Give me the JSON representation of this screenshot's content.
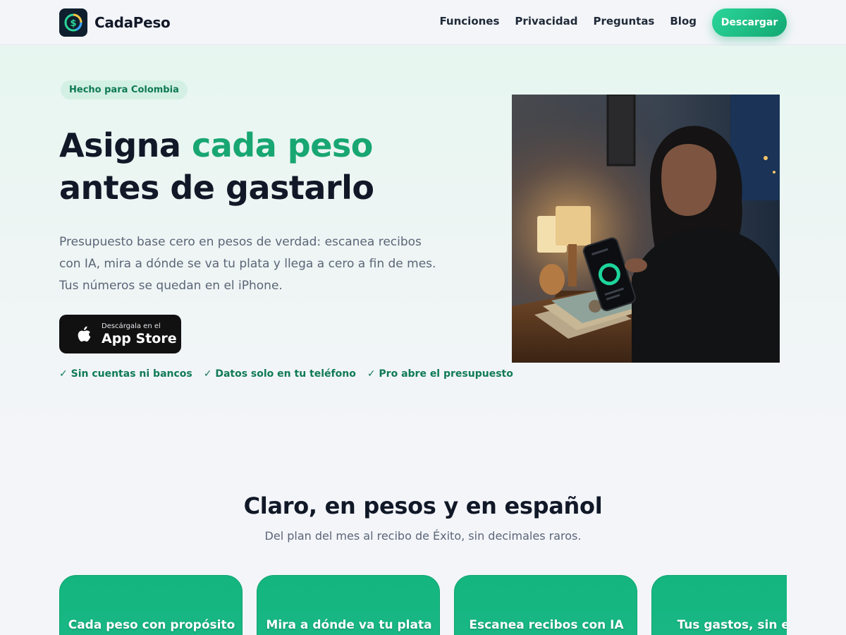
{
  "brand": {
    "name": "CadaPeso"
  },
  "nav": {
    "links": [
      "Funciones",
      "Privacidad",
      "Preguntas",
      "Blog"
    ],
    "cta": "Descargar"
  },
  "hero": {
    "badge": "Hecho para Colombia",
    "headline_part1": "Asigna ",
    "headline_accent": "cada peso",
    "headline_part2": " antes de gastarlo",
    "lead": "Presupuesto base cero en pesos de verdad: escanea recibos con IA, mira a dónde se va tu plata y llega a cero a fin de mes. Tus números se quedan en el iPhone.",
    "appstore_small": "Descárgala en el",
    "appstore_big": "App Store",
    "checks": [
      "✓ Sin cuentas ni bancos",
      "✓ Datos solo en tu teléfono",
      "✓ Pro abre el presupuesto"
    ]
  },
  "features": {
    "title": "Claro, en pesos y en español",
    "subtitle": "Del plan del mes al recibo de Éxito, sin decimales raros.",
    "cards": [
      "Cada peso con propósito",
      "Mira a dónde va tu plata",
      "Escanea recibos con IA",
      "Tus gastos, sin esfu"
    ]
  },
  "colors": {
    "accent": "#18a672",
    "cta_gradient_start": "#2bd69a",
    "cta_gradient_end": "#13a872",
    "card_green": "#14b57e"
  }
}
